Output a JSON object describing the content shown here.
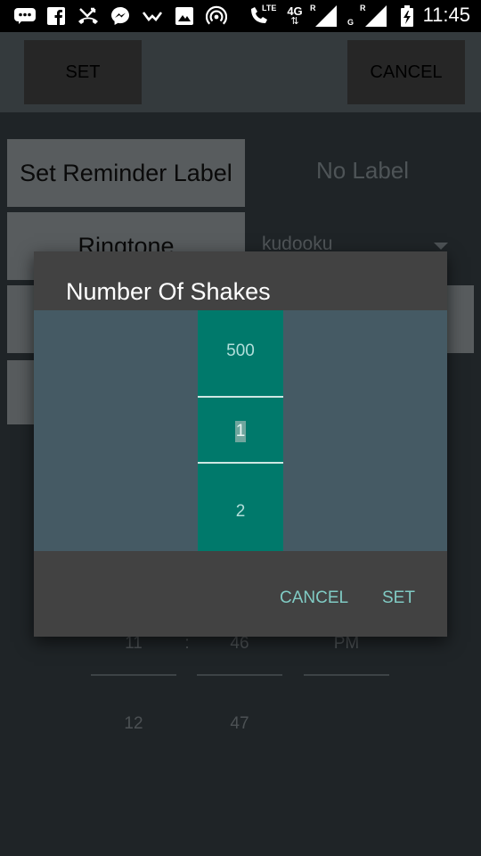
{
  "status_bar": {
    "time": "11:45",
    "network_1": "4G",
    "roaming_1": "R",
    "roaming_2": "R",
    "network_2": "G",
    "lte": "LTE",
    "icons": [
      "bbm-icon",
      "facebook-icon",
      "missed-call-icon",
      "messenger-icon",
      "notification-icon",
      "gallery-icon",
      "hotspot-icon",
      "volte-call-icon",
      "signal-icon",
      "signal-icon",
      "battery-charging-icon"
    ]
  },
  "toolbar": {
    "set_label": "SET",
    "cancel_label": "CANCEL"
  },
  "background": {
    "reminder_label_button": "Set Reminder Label",
    "reminder_label_value": "No Label",
    "ringtone_button": "Ringtone",
    "ringtone_value": "kudooku",
    "time_picker": {
      "hour_current": "11",
      "separator": ":",
      "minute_current": "46",
      "ampm_current": "PM",
      "hour_next": "12",
      "minute_next": "47"
    }
  },
  "dialog": {
    "title": "Number Of Shakes",
    "picker": {
      "previous": "500",
      "selected": "1",
      "next": "2"
    },
    "cancel_label": "CANCEL",
    "set_label": "SET"
  },
  "colors": {
    "dialog_bg": "#424242",
    "picker_bg": "#455a64",
    "picker_column": "#00796b",
    "accent": "#80cbc4"
  }
}
